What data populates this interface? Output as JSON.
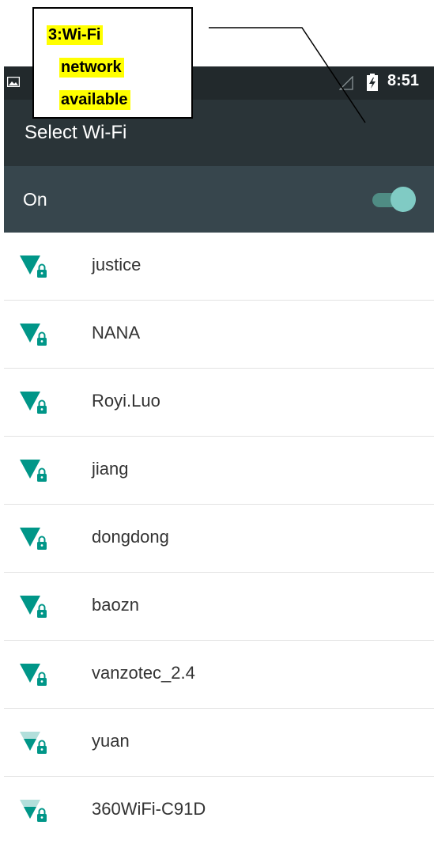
{
  "status_bar": {
    "time": "8:51",
    "icons": [
      "image-icon",
      "signal-icon",
      "battery-charging-icon"
    ]
  },
  "app_bar": {
    "title": "Select Wi-Fi"
  },
  "wifi_toggle": {
    "label": "On",
    "state": "on"
  },
  "networks": [
    {
      "name": "justice",
      "signal": "full",
      "secured": true
    },
    {
      "name": "NANA",
      "signal": "full",
      "secured": true
    },
    {
      "name": "Royi.Luo",
      "signal": "full",
      "secured": true
    },
    {
      "name": "jiang",
      "signal": "full",
      "secured": true
    },
    {
      "name": "dongdong",
      "signal": "full",
      "secured": true
    },
    {
      "name": "baozn",
      "signal": "full",
      "secured": true
    },
    {
      "name": "vanzotec_2.4",
      "signal": "full",
      "secured": true
    },
    {
      "name": "yuan",
      "signal": "medium",
      "secured": true
    },
    {
      "name": "360WiFi-C91D",
      "signal": "medium",
      "secured": true
    }
  ],
  "annotation": {
    "lines": [
      "3:Wi-Fi",
      "network",
      "available"
    ]
  },
  "colors": {
    "status_bar": "#22292c",
    "app_bar": "#2a3438",
    "on_bar": "#37464d",
    "accent": "#009688",
    "accent_light": "#80cbc4",
    "highlight": "#ffff00"
  }
}
